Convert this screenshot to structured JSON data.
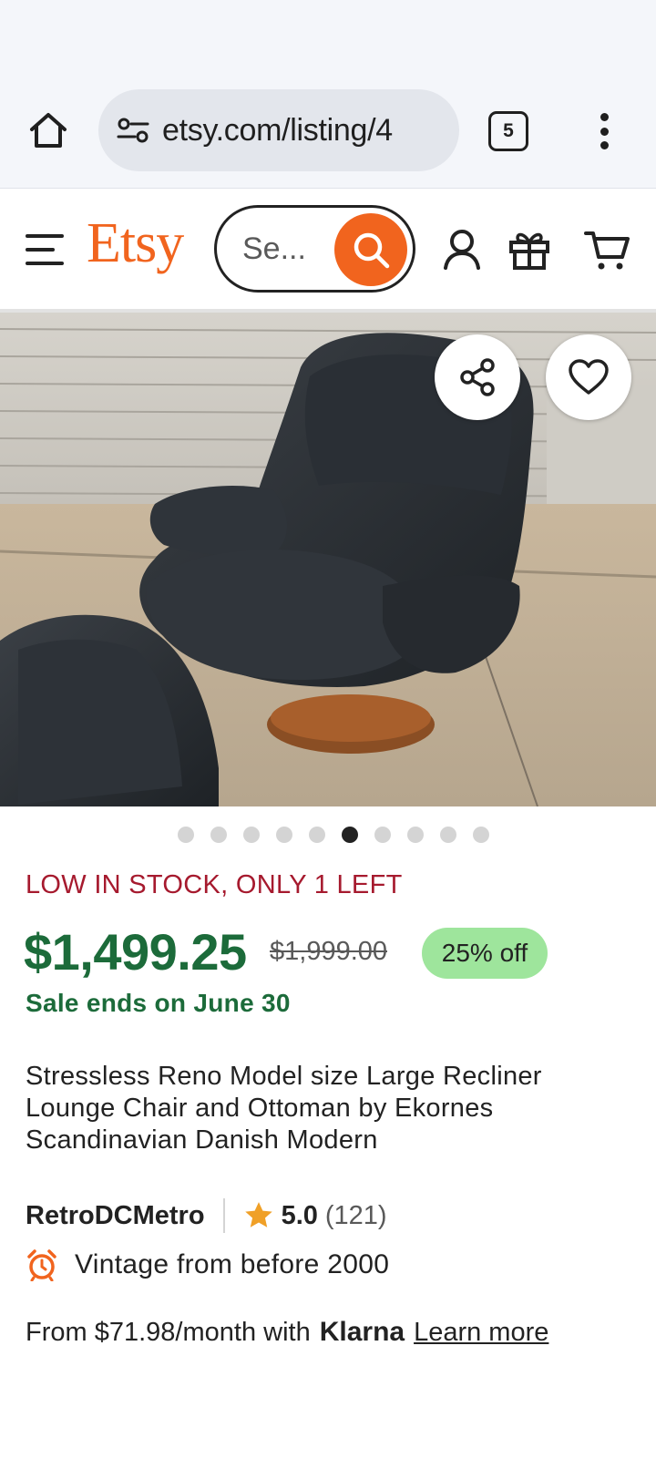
{
  "browser": {
    "url": "etsy.com/listing/4",
    "tab_count": "5"
  },
  "header": {
    "logo": "Etsy",
    "search_placeholder": "Se..."
  },
  "gallery": {
    "total_images": 10,
    "active_index": 5
  },
  "product": {
    "stock_notice": "LOW IN STOCK, ONLY 1 LEFT",
    "price": "$1,499.25",
    "original_price": "$1,999.00",
    "discount": "25% off",
    "sale_ends": "Sale ends on June 30",
    "title": "Stressless Reno Model size Large Recliner Lounge Chair and Ottoman by Ekornes Scandinavian Danish Modern"
  },
  "seller": {
    "shop_name": "RetroDCMetro",
    "rating": "5.0",
    "review_count": "(121)"
  },
  "vintage": {
    "label": "Vintage from before 2000"
  },
  "financing": {
    "text": "From $71.98/month with",
    "provider": "Klarna",
    "link": "Learn more"
  },
  "colors": {
    "brand_orange": "#f1641e",
    "price_green": "#1c6b3a",
    "stock_red": "#a61a2e",
    "discount_bg": "#9ee59c",
    "star": "#f0a027"
  }
}
